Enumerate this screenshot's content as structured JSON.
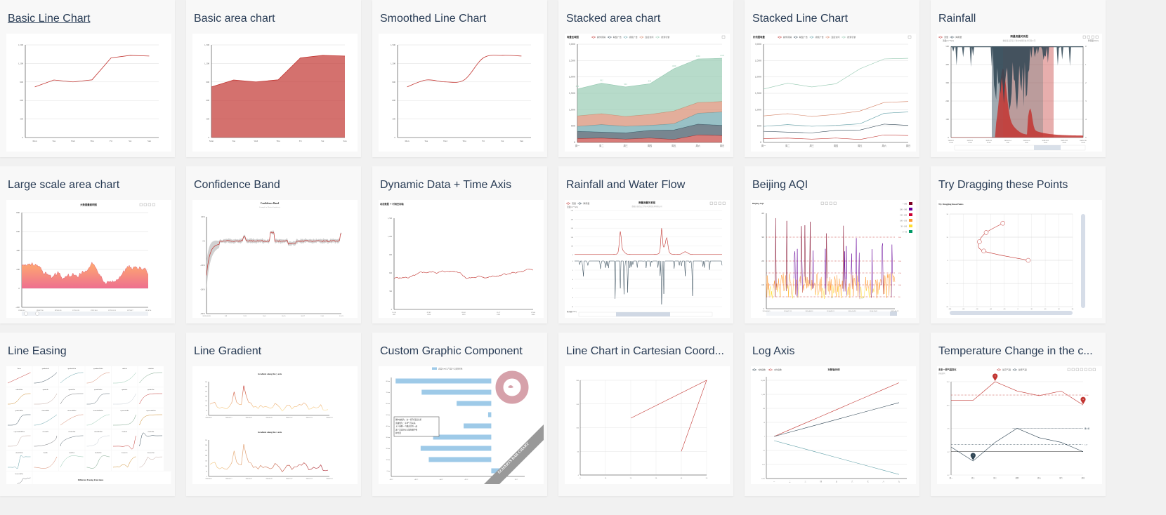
{
  "gallery": {
    "cards": [
      {
        "id": "line-simple",
        "title": "Basic Line Chart",
        "active": true
      },
      {
        "id": "area-basic",
        "title": "Basic area chart"
      },
      {
        "id": "line-smooth",
        "title": "Smoothed Line Chart"
      },
      {
        "id": "area-stack",
        "title": "Stacked area chart"
      },
      {
        "id": "line-stack",
        "title": "Stacked Line Chart"
      },
      {
        "id": "area-rainfall",
        "title": "Rainfall"
      },
      {
        "id": "area-simple",
        "title": "Large scale area chart"
      },
      {
        "id": "confidence-band",
        "title": "Confidence Band"
      },
      {
        "id": "dynamic-data2",
        "title": "Dynamic Data + Time Axis"
      },
      {
        "id": "grid-multiple",
        "title": "Rainfall and Water Flow"
      },
      {
        "id": "line-aqi",
        "title": "Beijing AQI"
      },
      {
        "id": "line-draggable",
        "title": "Try Dragging these Points"
      },
      {
        "id": "line-easing",
        "title": "Line Easing"
      },
      {
        "id": "line-gradient",
        "title": "Line Gradient"
      },
      {
        "id": "line-graphic",
        "title": "Custom Graphic Component"
      },
      {
        "id": "line-in-cartesian",
        "title": "Line Chart in Cartesian Coord..."
      },
      {
        "id": "line-log",
        "title": "Log Axis"
      },
      {
        "id": "line-marker",
        "title": "Temperature Change in the c..."
      }
    ]
  },
  "colors": {
    "page_bg": "#f1f1f1",
    "card_bg": "#f8f8f8",
    "title": "#293c55",
    "red": "#c23531",
    "navy": "#2f4554",
    "teal": "#61a0a8",
    "orange": "#d48265",
    "green": "#91c7ae"
  },
  "chart_data": [
    {
      "id": "line-simple",
      "type": "line",
      "categories": [
        "Mon",
        "Tue",
        "Wed",
        "Thu",
        "Fri",
        "Sat",
        "Sun"
      ],
      "values": [
        820,
        932,
        901,
        934,
        1290,
        1330,
        1320
      ],
      "ylim": [
        0,
        1500
      ],
      "yticks": [
        "0",
        "300",
        "600",
        "900",
        "1,200",
        "1,500"
      ]
    },
    {
      "id": "area-basic",
      "type": "area",
      "categories": [
        "Mon",
        "Tue",
        "Wed",
        "Thu",
        "Fri",
        "Sat",
        "Sun"
      ],
      "values": [
        820,
        932,
        901,
        934,
        1290,
        1330,
        1320
      ],
      "ylim": [
        0,
        1500
      ],
      "yticks": [
        "0",
        "300",
        "600",
        "900",
        "1,200",
        "1,500"
      ]
    },
    {
      "id": "line-smooth",
      "type": "line",
      "smooth": true,
      "categories": [
        "Mon",
        "Tue",
        "Wed",
        "Thu",
        "Fri",
        "Sat",
        "Sun"
      ],
      "values": [
        820,
        932,
        901,
        934,
        1290,
        1330,
        1320
      ],
      "ylim": [
        0,
        1500
      ],
      "yticks": [
        "0",
        "300",
        "600",
        "900",
        "1,200",
        "1,500"
      ]
    },
    {
      "id": "area-stack",
      "type": "area",
      "stacked": true,
      "title": "堆叠区域图",
      "categories": [
        "周一",
        "周二",
        "周三",
        "周四",
        "周五",
        "周六",
        "周日"
      ],
      "ylim": [
        0,
        3000
      ],
      "yticks": [
        "0",
        "500",
        "1,000",
        "1,500",
        "2,000",
        "2,500",
        "3,000"
      ],
      "series": [
        {
          "name": "邮件营销",
          "values": [
            120,
            132,
            101,
            134,
            90,
            230,
            210
          ]
        },
        {
          "name": "联盟广告",
          "values": [
            220,
            182,
            191,
            234,
            290,
            330,
            310
          ]
        },
        {
          "name": "视频广告",
          "values": [
            150,
            232,
            201,
            154,
            190,
            330,
            410
          ]
        },
        {
          "name": "直接访问",
          "values": [
            320,
            332,
            301,
            334,
            390,
            330,
            320
          ]
        },
        {
          "name": "搜索引擎",
          "values": [
            820,
            932,
            901,
            934,
            1290,
            1330,
            1320
          ]
        }
      ],
      "labels": [
        "820",
        "932",
        "901",
        "934",
        "1290",
        "1330",
        "1320"
      ]
    },
    {
      "id": "line-stack",
      "type": "line",
      "stacked": true,
      "title": "折线图堆叠",
      "categories": [
        "周一",
        "周二",
        "周三",
        "周四",
        "周五",
        "周六",
        "周日"
      ],
      "ylim": [
        0,
        3000
      ],
      "yticks": [
        "0",
        "500",
        "1,000",
        "1,500",
        "2,000",
        "2,500",
        "3,000"
      ],
      "series": [
        {
          "name": "邮件营销",
          "values": [
            120,
            132,
            101,
            134,
            90,
            230,
            210
          ]
        },
        {
          "name": "联盟广告",
          "values": [
            220,
            182,
            191,
            234,
            290,
            330,
            310
          ]
        },
        {
          "name": "视频广告",
          "values": [
            150,
            232,
            201,
            154,
            190,
            330,
            410
          ]
        },
        {
          "name": "直接访问",
          "values": [
            320,
            332,
            301,
            334,
            390,
            330,
            320
          ]
        },
        {
          "name": "搜索引擎",
          "values": [
            820,
            932,
            901,
            934,
            1290,
            1330,
            1320
          ]
        }
      ]
    },
    {
      "id": "area-rainfall",
      "type": "area",
      "title": "雨量流量关系图",
      "subtitle": "数据来自西安兰特水电测控技术有限公司",
      "legend": [
        "流量",
        "降雨量"
      ],
      "ylabel_left": "流量(m^3/s)",
      "ylabel_right": "降雨量(mm)",
      "yticks_left": [
        "0",
        "100",
        "200",
        "300",
        "400",
        "500"
      ],
      "yticks_right": [
        "5",
        "4",
        "3",
        "2",
        "1",
        "0"
      ],
      "xticks": [
        "2009/6/1\n12:00",
        "2009/6/5\n17:00",
        "2009/6/9\n22:00",
        "2009/6/14\n3:00",
        "2009/6/18\n8:00",
        "2009/6/22\n13:00",
        "2009/6/26\n18:00",
        "2009/6/30\n23:00"
      ]
    },
    {
      "id": "area-simple",
      "type": "area",
      "title": "大数据量面积图",
      "ylim": [
        -200,
        800
      ],
      "yticks": [
        "-200",
        "0",
        "200",
        "400",
        "600",
        "800"
      ],
      "xticks": [
        "1968/10/3",
        "1969/7/30",
        "1970/5/26",
        "1971/3/22",
        "1972/1/16",
        "1972/11/11",
        "1973/9/7",
        "1974/7/4"
      ]
    },
    {
      "id": "confidence-band",
      "type": "line",
      "title": "Confidence Band",
      "subtitle": "Example in MetricsGraphics.js",
      "yticks": [
        "-300%",
        "-200%",
        "-100%",
        "0%",
        "100%"
      ],
      "xticks": [
        "2012-08-28",
        "9-9",
        "9-21",
        "10-3",
        "10-15",
        "10-27",
        "11-8",
        "11-21"
      ]
    },
    {
      "id": "dynamic-data2",
      "type": "line",
      "title": "动态数据 + 时间坐标轴",
      "ylim": [
        0,
        1500
      ],
      "yticks": [
        "0",
        "300",
        "600",
        "900",
        "1,200",
        "1,500"
      ],
      "xticks": [
        "11-20\n1997",
        "07-03\n1998",
        "03-16\n1999",
        "11-17\n1999",
        "07-04\n2000"
      ]
    },
    {
      "id": "grid-multiple",
      "type": "line",
      "title": "雨量流量关系图",
      "subtitle": "数据来自西安兰特水电测控技术有限公司",
      "legend": [
        "流量",
        "降雨量"
      ],
      "ylabel_top": "流量(m^3/s)",
      "ylabel_bottom": "降雨量(mm)",
      "yticks_top": [
        "0",
        "100",
        "200",
        "300",
        "400",
        "500"
      ],
      "yticks_bottom": [
        "0",
        "2",
        "4",
        "6",
        "8",
        "10"
      ]
    },
    {
      "id": "line-aqi",
      "type": "line",
      "title": "Beijing AQI",
      "yticks": [
        "0",
        "100",
        "200",
        "300",
        "400"
      ],
      "xticks": [
        "2014-06-05",
        "2014-07-11",
        "2014-08-16",
        "2014-09-21",
        "2014-10-28",
        "2014-12-03",
        "2015-01-22"
      ],
      "markLines": [
        50,
        100,
        150,
        200,
        300
      ],
      "pieces": [
        {
          "label": "> 300",
          "color": "#7e0023"
        },
        {
          "label": "200 - 300",
          "color": "#660099"
        },
        {
          "label": "150 - 200",
          "color": "#cc0033"
        },
        {
          "label": "100 - 150",
          "color": "#ff9933"
        },
        {
          "label": "50 - 100",
          "color": "#ffde33"
        },
        {
          "label": "0 - 50",
          "color": "#096"
        }
      ]
    },
    {
      "id": "line-draggable",
      "type": "line",
      "title": "Try Dragging these Points",
      "points": [
        [
          15,
          0
        ],
        [
          -50,
          10
        ],
        [
          -56.5,
          20
        ],
        [
          -46.5,
          30
        ],
        [
          -22.1,
          40
        ]
      ],
      "xlim": [
        -100,
        80
      ],
      "ylim": [
        -50,
        50
      ],
      "xticks": [
        "-100",
        "-80",
        "-60",
        "-40",
        "-20",
        "0",
        "20",
        "40",
        "60",
        "80"
      ],
      "yticks": [
        "-50",
        "-25",
        "0",
        "25",
        "50"
      ]
    },
    {
      "id": "line-easing",
      "type": "line",
      "title": "Different Easing Functions",
      "easings": [
        "linear",
        "quadraticIn",
        "quadraticOut",
        "quadraticInOut",
        "cubicIn",
        "cubicOut",
        "cubicInOut",
        "quarticIn",
        "quarticOut",
        "quarticInOut",
        "quinticIn",
        "quinticOut",
        "quinticInOut",
        "sinusoidalIn",
        "sinusoidalOut",
        "sinusoidalInOut",
        "exponentialIn",
        "exponentialOut",
        "exponentialInOut",
        "circularIn",
        "circularOut",
        "circularInOut",
        "elasticIn",
        "elasticOut",
        "elasticInOut",
        "backIn",
        "backOut",
        "backInOut",
        "bounceIn",
        "bounceOut",
        "bounceInOut"
      ]
    },
    {
      "id": "line-gradient",
      "type": "line",
      "titles": [
        "Gradient along the y axis",
        "Gradient along the x axis"
      ],
      "values": [
        116,
        129,
        135,
        86,
        73,
        85,
        73,
        68,
        92,
        130,
        245,
        139,
        115,
        111,
        309,
        206,
        137,
        128,
        85,
        94,
        71,
        106,
        84,
        93,
        85,
        73,
        83,
        125,
        107,
        82,
        44,
        72,
        106,
        107,
        66,
        91,
        92,
        113,
        107,
        131,
        111,
        64,
        69,
        88,
        77,
        83,
        111,
        57,
        55,
        60
      ],
      "yticks": [
        "0",
        "50",
        "100",
        "150",
        "200",
        "250",
        "300",
        "350"
      ],
      "xticks": [
        "2000-06-05",
        "2000-06-13",
        "2000-06-21",
        "2000-06-29",
        "2000-07-07",
        "2000-07-15",
        "2000-07-23"
      ]
    },
    {
      "id": "line-graphic",
      "type": "bar",
      "legend": [
        "高度(km)与气温(°C)变化关系"
      ],
      "categories": [
        "0 km",
        "10 km",
        "20 km",
        "30 km",
        "40 km",
        "50 km",
        "60 km",
        "70 km",
        "80 km"
      ],
      "values": [
        15,
        -50,
        -56.5,
        -46.5,
        -22.1,
        -2.5,
        -27.7,
        -55.7,
        -76.5
      ],
      "xticks": [
        "-80°C",
        "-60°C",
        "-40°C",
        "-20°C",
        "0°C",
        "20°C"
      ],
      "note": "图中曲线为：左一系列 温度关系\n该曲线为：平均气压关系\n上下两侧一个图表合在一起\n这个文本块可以放在图中各\n种位置",
      "watermark": "ECHARTS BAR CHART"
    },
    {
      "id": "line-in-cartesian",
      "type": "line",
      "points": [
        [
          20,
          120
        ],
        [
          50,
          200
        ],
        [
          40,
          50
        ]
      ],
      "xlim": [
        0,
        50
      ],
      "ylim": [
        0,
        200
      ],
      "xticks": [
        "0",
        "10",
        "20",
        "30",
        "40",
        "50"
      ],
      "yticks": [
        "0",
        "50",
        "100",
        "150",
        "200"
      ]
    },
    {
      "id": "line-log",
      "type": "line",
      "title": "对数轴示例",
      "legend": [
        "3的指数",
        "2的指数",
        "1/2的指数"
      ],
      "categories": [
        "一",
        "二",
        "三",
        "四",
        "五",
        "六",
        "七",
        "八",
        "九"
      ],
      "series": [
        {
          "name": "3的指数",
          "values": [
            1,
            3,
            9,
            27,
            81,
            247,
            741,
            2223,
            6669
          ]
        },
        {
          "name": "2的指数",
          "values": [
            1,
            2,
            4,
            8,
            16,
            32,
            64,
            128,
            256
          ]
        },
        {
          "name": "1/2的指数",
          "values": [
            0.5,
            0.25,
            0.125,
            0.0625,
            0.03125,
            0.015625,
            0.0078125,
            0.00390625,
            0.001953125
          ]
        }
      ],
      "yticks": [
        "0.001",
        "0.01",
        "0.1",
        "1",
        "10",
        "100",
        "1,000",
        "10,000"
      ]
    },
    {
      "id": "line-marker",
      "type": "line",
      "title": "未来一周气温变化",
      "subtitle": "纯属虚构",
      "legend": [
        "最高气温",
        "最低气温"
      ],
      "categories": [
        "周一",
        "周二",
        "周三",
        "周四",
        "周五",
        "周六",
        "周日"
      ],
      "series": [
        {
          "name": "最高气温",
          "values": [
            11,
            11,
            15,
            13,
            12,
            13,
            10
          ]
        },
        {
          "name": "最低气温",
          "values": [
            1,
            -2,
            2,
            5,
            3,
            2,
            0
          ]
        }
      ],
      "yticks": [
        "-5°C",
        "0°C",
        "5°C",
        "10°C",
        "15°C"
      ],
      "markPoints": {
        "max": "15",
        "min_high": "10",
        "min_low": "-2"
      },
      "markLines": {
        "avg_high": "12.14",
        "avg_low": "1.57",
        "max_label": "最大值"
      }
    }
  ]
}
